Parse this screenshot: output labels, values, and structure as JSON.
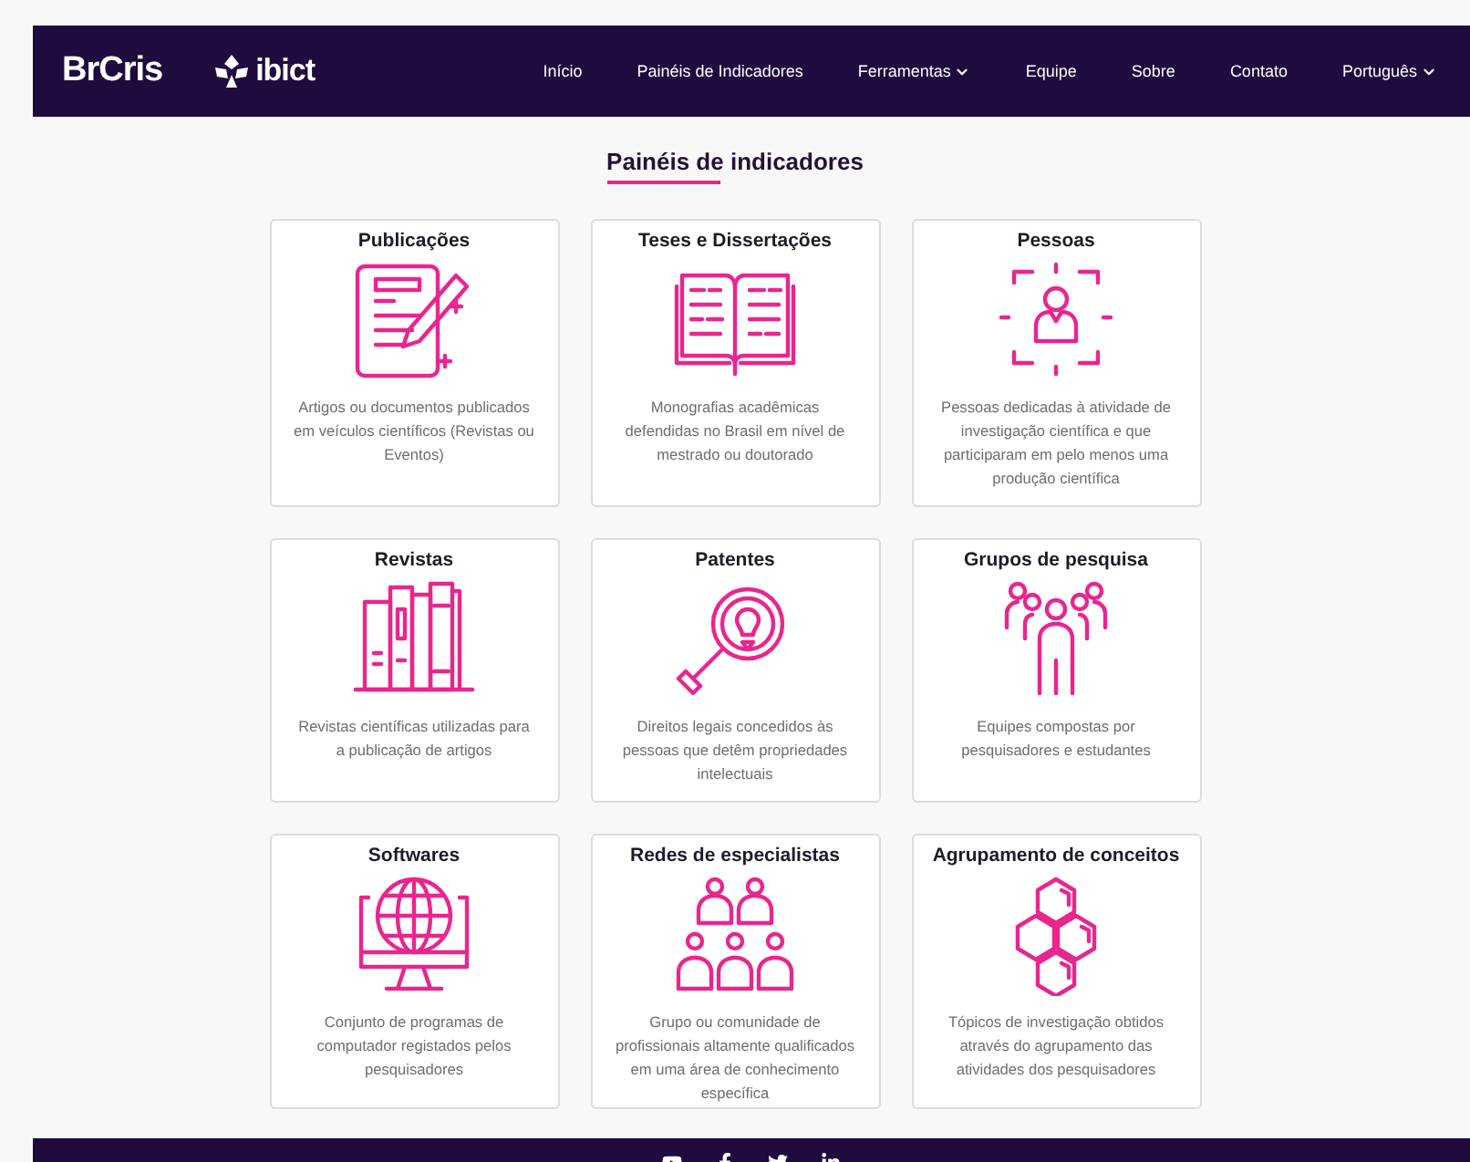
{
  "header": {
    "logos": [
      {
        "text": "BrCris"
      },
      {
        "text": "ibict"
      }
    ],
    "nav": [
      {
        "label": "Início",
        "dropdown": false
      },
      {
        "label": "Painéis de Indicadores",
        "dropdown": false
      },
      {
        "label": "Ferramentas",
        "dropdown": true
      },
      {
        "label": "Equipe",
        "dropdown": false
      },
      {
        "label": "Sobre",
        "dropdown": false
      },
      {
        "label": "Contato",
        "dropdown": false
      },
      {
        "label": "Português",
        "dropdown": true
      }
    ]
  },
  "heading": "Painéis de indicadores",
  "cards": [
    {
      "title": "Publicações",
      "description": "Artigos ou documentos publicados em veículos científicos (Revistas ou Eventos)"
    },
    {
      "title": "Teses e Dissertações",
      "description": "Monografias acadêmicas defendidas no Brasil em nível de mestrado ou doutorado"
    },
    {
      "title": "Pessoas",
      "description": "Pessoas dedicadas à atividade de investigação científica e que participaram em pelo menos uma produção científica"
    },
    {
      "title": "Revistas",
      "description": "Revistas científicas utilizadas para a publicação de artigos"
    },
    {
      "title": "Patentes",
      "description": "Direitos legais concedidos às pessoas que detêm propriedades intelectuais"
    },
    {
      "title": "Grupos de pesquisa",
      "description": "Equipes compostas por pesquisadores e estudantes"
    },
    {
      "title": "Softwares",
      "description": "Conjunto de programas de computador registados pelos pesquisadores"
    },
    {
      "title": "Redes de especialistas",
      "description": "Grupo ou comunidade de profissionais altamente qualificados em uma área de conhecimento específica"
    },
    {
      "title": "Agrupamento de conceitos",
      "description": "Tópicos de investigação obtidos através do agrupamento das atividades dos pesquisadores"
    }
  ]
}
